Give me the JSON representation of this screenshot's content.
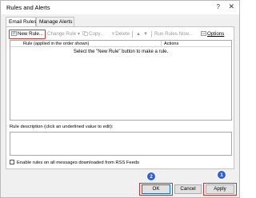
{
  "window": {
    "title": "Rules and Alerts",
    "help_icon": "?",
    "close_icon": "✕"
  },
  "tabs": [
    {
      "label": "Email Rules",
      "active": true
    },
    {
      "label": "Manage Alerts",
      "active": false
    }
  ],
  "toolbar": {
    "new_rule": "New Rule...",
    "change_rule": "Change Rule",
    "copy": "Copy...",
    "delete": "Delete",
    "run_rules_now": "Run Rules Now...",
    "options": "Options",
    "dropdown_glyph": "▾",
    "up_glyph": "▲",
    "down_glyph": "▼"
  },
  "rules_table": {
    "columns": [
      "Rule (applied in the order shown)",
      "Actions"
    ],
    "empty_hint": "Select the \"New Rule\" button to make a rule."
  },
  "description": {
    "label": "Rule description (click an underlined value to edit):"
  },
  "rss": {
    "label": "Enable rules on all messages downloaded from RSS Feeds",
    "checked": false
  },
  "buttons": {
    "ok": "OK",
    "cancel": "Cancel",
    "apply": "Apply"
  },
  "annotations": {
    "badge_apply": "1",
    "badge_ok": "2",
    "marker_color": "#d22f2f",
    "badge_color": "#2f5ce0"
  }
}
